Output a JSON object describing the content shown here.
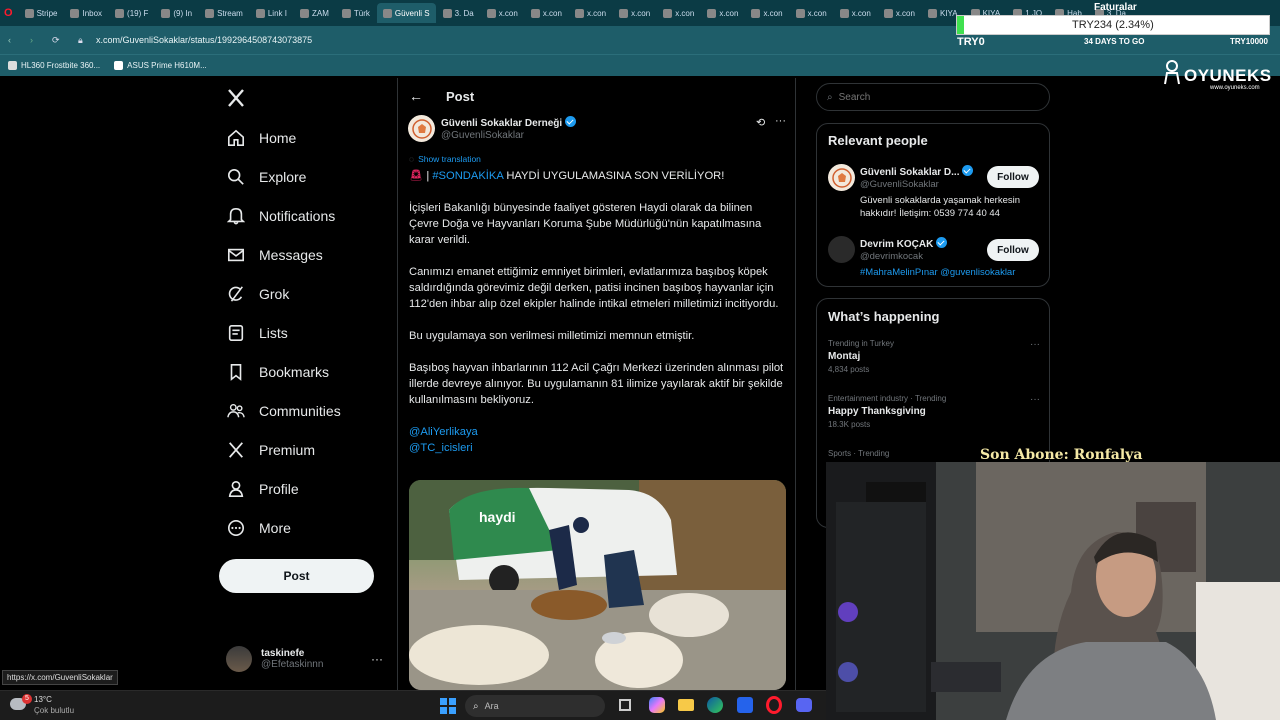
{
  "browser": {
    "tabs": [
      {
        "label": "Stripe"
      },
      {
        "label": "Inbox"
      },
      {
        "label": "(19) F"
      },
      {
        "label": "(9) In"
      },
      {
        "label": "Stream"
      },
      {
        "label": "Link I"
      },
      {
        "label": "ZAM"
      },
      {
        "label": "Türk"
      },
      {
        "label": "Güvenli S"
      },
      {
        "label": "3. Da"
      },
      {
        "label": "x.con"
      },
      {
        "label": "x.con"
      },
      {
        "label": "x.con"
      },
      {
        "label": "x.con"
      },
      {
        "label": "x.con"
      },
      {
        "label": "x.con"
      },
      {
        "label": "x.con"
      },
      {
        "label": "x.con"
      },
      {
        "label": "x.con"
      },
      {
        "label": "x.con"
      },
      {
        "label": "KIYA"
      },
      {
        "label": "KIYA"
      },
      {
        "label": "1.JO"
      },
      {
        "label": "Hab"
      },
      {
        "label": "3. Da"
      }
    ],
    "url": "x.com/GuvenliSokaklar/status/1992964508743073875",
    "bookmarks": [
      {
        "label": "HL360 Frostbite 360..."
      },
      {
        "label": "ASUS Prime H610M..."
      }
    ],
    "status_url": "https://x.com/GuvenliSokaklar"
  },
  "overlay": {
    "faturalar": "Faturalar",
    "goal_amount": "TRY234 (2.34%)",
    "goal_start": "TRY0",
    "goal_days": "34 DAYS TO GO",
    "goal_end": "TRY10000",
    "brand": "OYUNEKS",
    "brand_url": "www.oyuneks.com",
    "last_sub": "Son Abone: Ronfalya"
  },
  "nav": {
    "items": [
      {
        "label": "Home",
        "icon": "home-icon"
      },
      {
        "label": "Explore",
        "icon": "search-icon"
      },
      {
        "label": "Notifications",
        "icon": "bell-icon"
      },
      {
        "label": "Messages",
        "icon": "envelope-icon"
      },
      {
        "label": "Grok",
        "icon": "grok-icon"
      },
      {
        "label": "Lists",
        "icon": "list-icon"
      },
      {
        "label": "Bookmarks",
        "icon": "bookmark-icon"
      },
      {
        "label": "Communities",
        "icon": "people-icon"
      },
      {
        "label": "Premium",
        "icon": "x-logo-icon"
      },
      {
        "label": "Profile",
        "icon": "person-icon"
      },
      {
        "label": "More",
        "icon": "more-circle-icon"
      }
    ],
    "post_button": "Post",
    "account": {
      "name": "taskinefe",
      "handle": "@Efetaskinnn"
    }
  },
  "post": {
    "header_title": "Post",
    "author_name": "Güvenli Sokaklar Derneği",
    "author_handle": "@GuvenliSokaklar",
    "show_translation": "Show translation",
    "headline_sep": "|",
    "hashtag": "#SONDAKİKA",
    "headline": "HAYDİ UYGULAMASINA SON VERİLİYOR!",
    "p1": "İçişleri Bakanlığı bünyesinde faaliyet gösteren Haydi olarak da bilinen Çevre Doğa ve Hayvanları Koruma Şube Müdürlüğü'nün kapatılmasına karar verildi.",
    "p2": "Canımızı emanet ettiğimiz emniyet birimleri, evlatlarımıza başıboş köpek saldırdığında görevimiz değil derken, patisi incinen başıboş hayvanlar için 112'den ihbar alıp özel ekipler halinde intikal etmeleri milletimizi incitiyordu.",
    "p3": "Bu uygulamaya son verilmesi milletimizi memnun etmiştir.",
    "p4": "Başıboş hayvan ihbarlarının 112 Acil Çağrı Merkezi üzerinden alınması pilot illerde devreye alınıyor. Bu uygulamanın 81 ilimize yayılarak aktif bir şekilde kullanılmasını bekliyoruz.",
    "mention1": "@AliYerlikaya",
    "mention2": "@TC_icisleri",
    "van_label": "haydi"
  },
  "sidebar": {
    "search_placeholder": "Search",
    "relevant_title": "Relevant people",
    "people": [
      {
        "name": "Güvenli Sokaklar D...",
        "handle": "@GuvenliSokaklar",
        "bio": "Güvenli sokaklarda yaşamak herkesin hakkıdır! İletişim: 0539 774 40 44",
        "follow": "Follow"
      },
      {
        "name": "Devrim KOÇAK",
        "handle": "@devrimkocak",
        "bio": "#MahraMelinPınar @guvenlisokaklar",
        "follow": "Follow"
      }
    ],
    "happening_title": "What’s happening",
    "trends": [
      {
        "context": "Trending in Turkey",
        "title": "Montaj",
        "count": "4,834 posts"
      },
      {
        "context": "Entertainment industry · Trending",
        "title": "Happy Thanksgiving",
        "count": "18.3K posts"
      },
      {
        "context": "Sports · Trending",
        "title": "",
        "count": ""
      }
    ]
  },
  "taskbar": {
    "temp": "13°C",
    "weather": "Çok bulutlu",
    "search": "Ara",
    "badge": "5"
  }
}
